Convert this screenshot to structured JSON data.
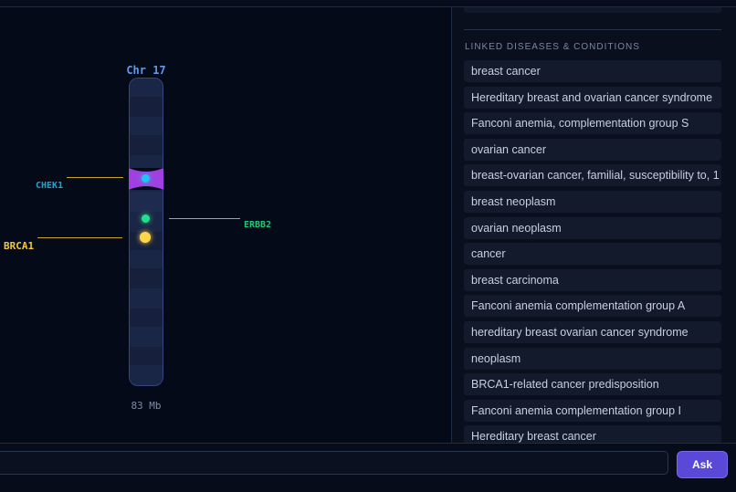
{
  "chromosome": {
    "title": "Chr 17",
    "size_label": "83 Mb",
    "genes": [
      {
        "name": "CHEK1",
        "color": "#1fc3f0"
      },
      {
        "name": "ERBB2",
        "color": "#22e08a"
      },
      {
        "name": "BRCA1",
        "color": "#ffd54a"
      }
    ],
    "centromere_color": "#a040e0"
  },
  "sidebar": {
    "section_title": "LINKED DISEASES & CONDITIONS",
    "diseases": [
      "breast cancer",
      "Hereditary breast and ovarian cancer syndrome",
      "Fanconi anemia, complementation group S",
      "ovarian cancer",
      "breast-ovarian cancer, familial, susceptibility to, 1",
      "breast neoplasm",
      "ovarian neoplasm",
      "cancer",
      "breast carcinoma",
      "Fanconi anemia complementation group A",
      "hereditary breast ovarian cancer syndrome",
      "neoplasm",
      "BRCA1-related cancer predisposition",
      "Fanconi anemia complementation group I",
      "Hereditary breast cancer"
    ]
  },
  "chat": {
    "input_value": "",
    "ask_label": "Ask"
  },
  "colors": {
    "accent": "#5a49d8",
    "background": "#050a18"
  }
}
